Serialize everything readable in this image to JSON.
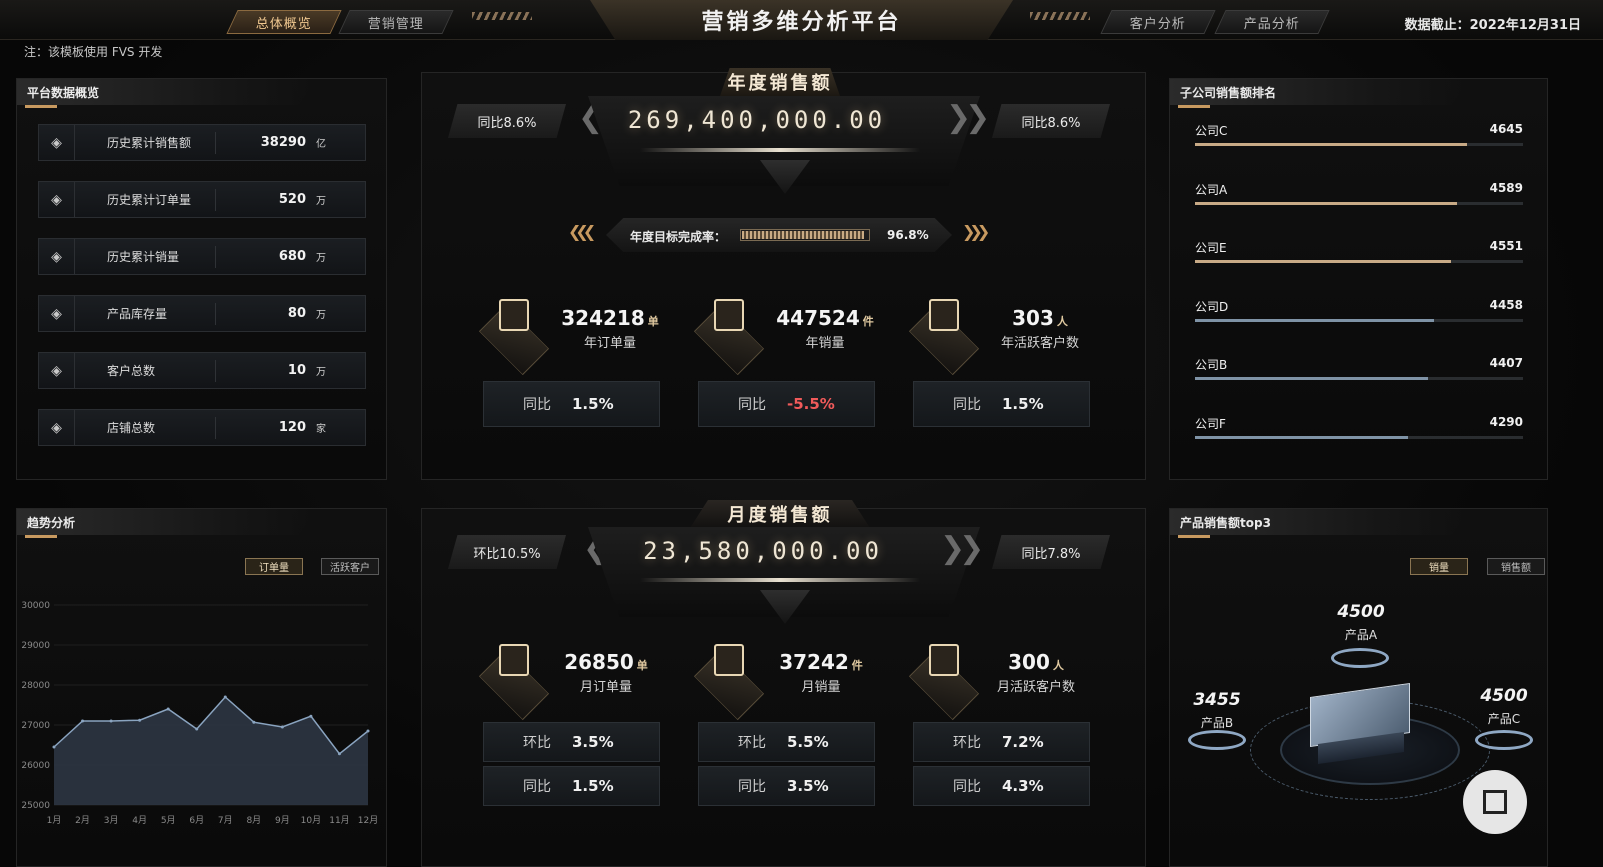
{
  "header": {
    "title": "营销多维分析平台",
    "date_label": "数据截止：",
    "date_value": "2022年12月31日",
    "nav_left": [
      "总体概览",
      "营销管理"
    ],
    "nav_right": [
      "客户分析",
      "产品分析"
    ],
    "active_tab": "总体概览"
  },
  "note": "注：该模板使用 FVS 开发",
  "overview": {
    "title": "平台数据概览",
    "items": [
      {
        "label": "历史累计销售额",
        "value": "38290",
        "unit": "亿"
      },
      {
        "label": "历史累计订单量",
        "value": "520",
        "unit": "万"
      },
      {
        "label": "历史累计销量",
        "value": "680",
        "unit": "万"
      },
      {
        "label": "产品库存量",
        "value": "80",
        "unit": "万"
      },
      {
        "label": "客户总数",
        "value": "10",
        "unit": "万"
      },
      {
        "label": "店铺总数",
        "value": "120",
        "unit": "家"
      }
    ]
  },
  "annual": {
    "title": "年度销售额",
    "amount": "269,400,000.00",
    "left_pill": "同比8.6%",
    "right_pill": "同比8.6%",
    "target_label": "年度目标完成率：",
    "target_value": "96.8%",
    "target_ratio": 0.968,
    "kpis": [
      {
        "value": "324218",
        "unit": "单",
        "label": "年订单量",
        "cmp": [
          {
            "k": "同比",
            "v": "1.5%",
            "neg": false
          }
        ]
      },
      {
        "value": "447524",
        "unit": "件",
        "label": "年销量",
        "cmp": [
          {
            "k": "同比",
            "v": "-5.5%",
            "neg": true
          }
        ]
      },
      {
        "value": "303",
        "unit": "人",
        "label": "年活跃客户数",
        "cmp": [
          {
            "k": "同比",
            "v": "1.5%",
            "neg": false
          }
        ]
      }
    ]
  },
  "monthly": {
    "title": "月度销售额",
    "amount": "23,580,000.00",
    "left_pill": "环比10.5%",
    "right_pill": "同比7.8%",
    "kpis": [
      {
        "value": "26850",
        "unit": "单",
        "label": "月订单量",
        "huan": "3.5%",
        "tong": "1.5%"
      },
      {
        "value": "37242",
        "unit": "件",
        "label": "月销量",
        "huan": "5.5%",
        "tong": "3.5%"
      },
      {
        "value": "300",
        "unit": "人",
        "label": "月活跃客户数",
        "huan": "7.2%",
        "tong": "4.3%"
      }
    ],
    "huan_label": "环比",
    "tong_label": "同比"
  },
  "ranking": {
    "title": "子公司销售额排名",
    "items": [
      {
        "name": "公司C",
        "value": "4645",
        "ratio": 0.83,
        "color": "#c8aa86"
      },
      {
        "name": "公司A",
        "value": "4589",
        "ratio": 0.8,
        "color": "#c8aa86"
      },
      {
        "name": "公司E",
        "value": "4551",
        "ratio": 0.78,
        "color": "#c8aa86"
      },
      {
        "name": "公司D",
        "value": "4458",
        "ratio": 0.73,
        "color": "#7f93a6"
      },
      {
        "name": "公司B",
        "value": "4407",
        "ratio": 0.71,
        "color": "#7f93a6"
      },
      {
        "name": "公司F",
        "value": "4290",
        "ratio": 0.65,
        "color": "#7f93a6"
      }
    ]
  },
  "trend": {
    "title": "趋势分析",
    "buttons": [
      "订单量",
      "活跃客户"
    ],
    "active": "订单量"
  },
  "chart_data": {
    "type": "area",
    "categories": [
      "1月",
      "2月",
      "3月",
      "4月",
      "5月",
      "6月",
      "7月",
      "8月",
      "9月",
      "10月",
      "11月",
      "12月"
    ],
    "values": [
      26450,
      27100,
      27100,
      27120,
      27400,
      26900,
      27700,
      27070,
      26950,
      27220,
      26280,
      26850
    ],
    "yticks": [
      30000,
      29000,
      28000,
      27000,
      26000,
      25000
    ],
    "ylim": [
      25000,
      30000
    ],
    "color": "#8aa4c0"
  },
  "products": {
    "title": "产品销售额top3",
    "buttons": [
      "销量",
      "销售额"
    ],
    "active": "销量",
    "items": [
      {
        "name": "产品A",
        "value": "4500"
      },
      {
        "name": "产品B",
        "value": "3455"
      },
      {
        "name": "产品C",
        "value": "4500"
      }
    ]
  }
}
